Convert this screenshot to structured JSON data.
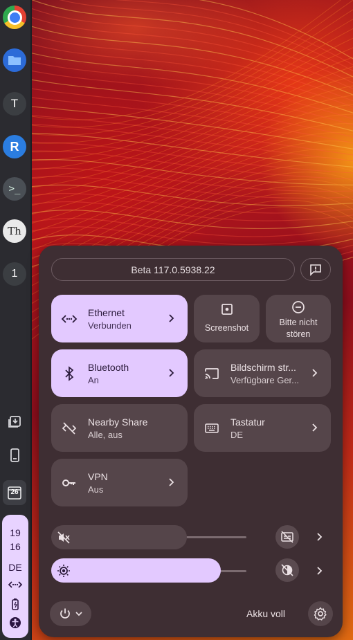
{
  "shelf": {
    "apps": [
      {
        "name": "chrome-icon"
      },
      {
        "name": "files-icon"
      },
      {
        "name": "terminal-app",
        "glyph": "T"
      },
      {
        "name": "rvnc-app",
        "glyph": "R"
      },
      {
        "name": "ssh-terminal-app",
        "glyph": ">_"
      },
      {
        "name": "th-app",
        "glyph": "Th"
      },
      {
        "name": "one-app",
        "glyph": "1"
      }
    ],
    "calendar_day": "26",
    "tray": {
      "hour": "19",
      "minute": "16",
      "ime": "DE"
    }
  },
  "quick_settings": {
    "version": "Beta 117.0.5938.22",
    "tiles": {
      "ethernet": {
        "label": "Ethernet",
        "sub": "Verbunden"
      },
      "screenshot": {
        "label": "Screenshot"
      },
      "dnd": {
        "label_line1": "Bitte nicht",
        "label_line2": "stören"
      },
      "bluetooth": {
        "label": "Bluetooth",
        "sub": "An"
      },
      "cast": {
        "label": "Bildschirm str...",
        "sub": "Verfügbare Ger..."
      },
      "nearby": {
        "label": "Nearby Share",
        "sub": "Alle, aus"
      },
      "keyboard": {
        "label": "Tastatur",
        "sub": "DE"
      },
      "vpn": {
        "label": "VPN",
        "sub": "Aus"
      }
    },
    "volume": {
      "level": 0.0,
      "muted": true
    },
    "brightness": {
      "level": 0.62
    },
    "battery_status": "Akku voll"
  },
  "colors": {
    "accent": "#e3c9ff",
    "panel": "#3e2e33",
    "tile_off": "#55454a"
  }
}
